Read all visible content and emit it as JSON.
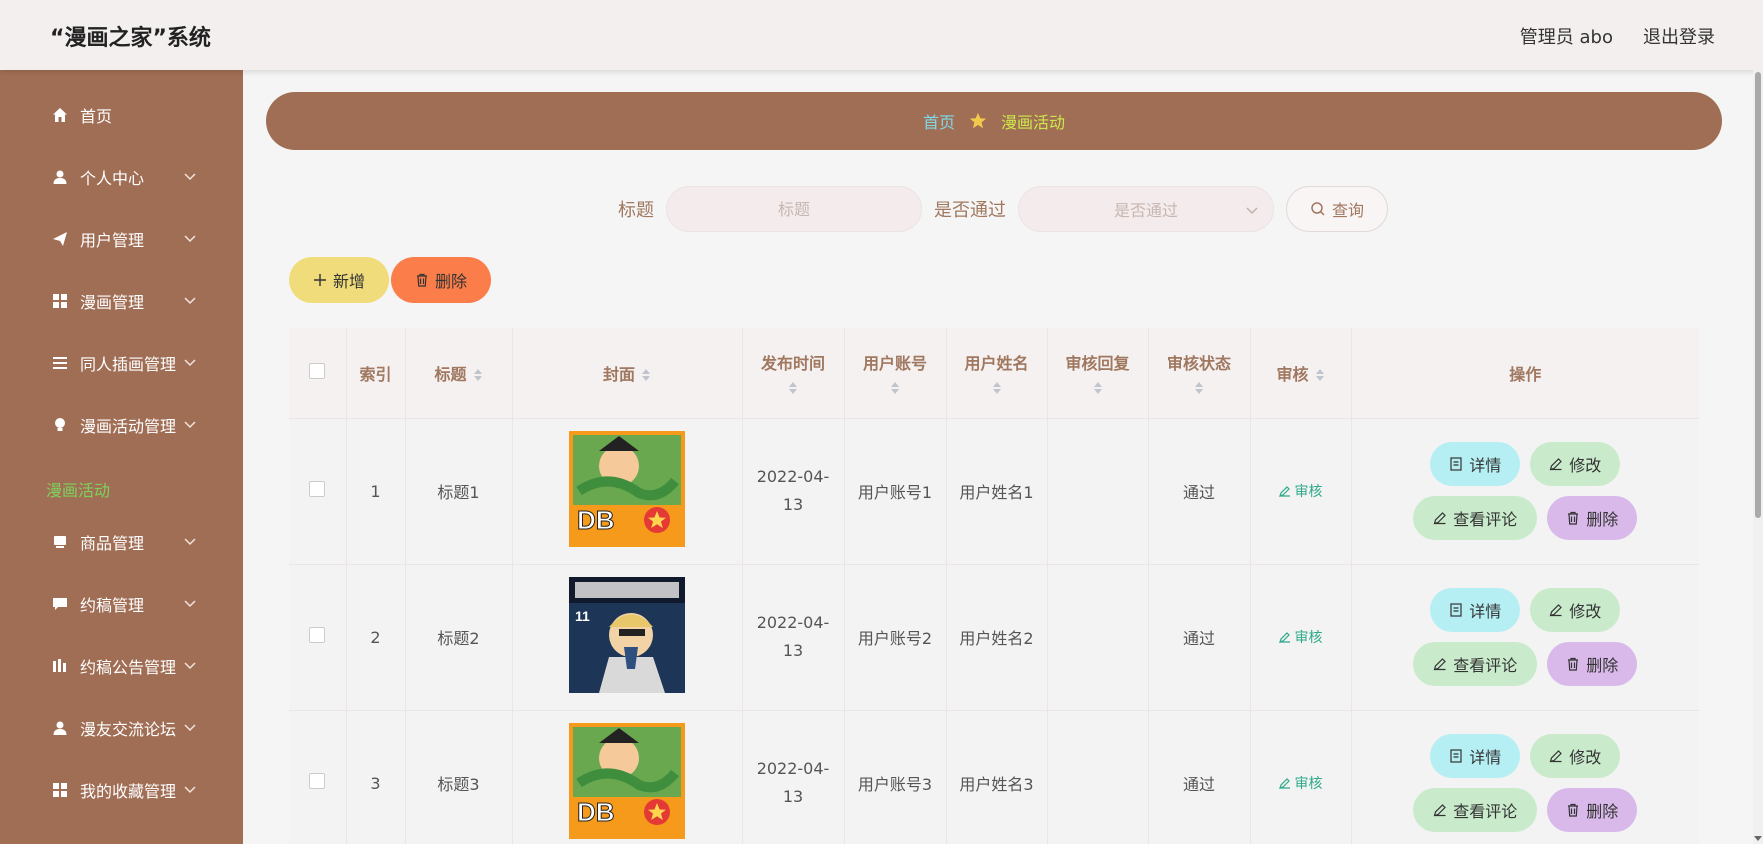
{
  "header": {
    "title": "“漫画之家”系统",
    "user": "管理员 abo",
    "logout": "退出登录"
  },
  "sidebar": {
    "items": [
      {
        "label": "首页",
        "icon": "home-icon",
        "expandable": false
      },
      {
        "label": "个人中心",
        "icon": "user-icon",
        "expandable": true
      },
      {
        "label": "用户管理",
        "icon": "send-icon",
        "expandable": true
      },
      {
        "label": "漫画管理",
        "icon": "grid-icon",
        "expandable": true
      },
      {
        "label": "同人插画管理",
        "icon": "list-icon",
        "expandable": true
      },
      {
        "label": "漫画活动管理",
        "icon": "bulb-icon",
        "expandable": true
      },
      {
        "label": "商品管理",
        "icon": "goods-icon",
        "expandable": true
      },
      {
        "label": "约稿管理",
        "icon": "chat-icon",
        "expandable": true
      },
      {
        "label": "约稿公告管理",
        "icon": "notice-icon",
        "expandable": true
      },
      {
        "label": "漫友交流论坛",
        "icon": "forum-user-icon",
        "expandable": true
      },
      {
        "label": "我的收藏管理",
        "icon": "collection-icon",
        "expandable": true
      }
    ],
    "active_sub": "漫画活动"
  },
  "breadcrumb": {
    "home": "首页",
    "current": "漫画活动"
  },
  "search": {
    "title_label": "标题",
    "title_placeholder": "标题",
    "pass_label": "是否通过",
    "pass_placeholder": "是否通过",
    "query": "查询"
  },
  "actions": {
    "add": "新增",
    "delete": "删除"
  },
  "table": {
    "headers": {
      "index": "索引",
      "title": "标题",
      "cover": "封面",
      "publish_time": "发布时间",
      "user_account": "用户账号",
      "user_name": "用户姓名",
      "reply": "审核回复",
      "status": "审核状态",
      "audit": "审核",
      "ops": "操作"
    },
    "rows": [
      {
        "index": "1",
        "title": "标题1",
        "time": "2022-04-13",
        "account": "用户账号1",
        "name": "用户姓名1",
        "reply": "",
        "status": "通过",
        "audit": "审核",
        "cover": "dragon-ball-cover"
      },
      {
        "index": "2",
        "title": "标题2",
        "time": "2022-04-13",
        "account": "用户账号2",
        "name": "用户姓名2",
        "reply": "",
        "status": "通过",
        "audit": "审核",
        "cover": "jujutsu-kaisen-cover"
      },
      {
        "index": "3",
        "title": "标题3",
        "time": "2022-04-13",
        "account": "用户账号3",
        "name": "用户姓名3",
        "reply": "",
        "status": "通过",
        "audit": "审核",
        "cover": "dragon-ball-cover"
      }
    ],
    "op_labels": {
      "detail": "详情",
      "edit": "修改",
      "comment": "查看评论",
      "delete": "删除"
    }
  },
  "colors": {
    "sidebar": "#a06e55",
    "active_sub": "#7fd15b",
    "breadcrumb_home": "#7fd8e6",
    "breadcrumb_current": "#cde84a",
    "add_button": "#f0dc7a",
    "delete_button": "#fb7d4a",
    "detail_button": "#b6eff3",
    "edit_button": "#c9ebcc",
    "op_delete_button": "#d8b9ea"
  }
}
